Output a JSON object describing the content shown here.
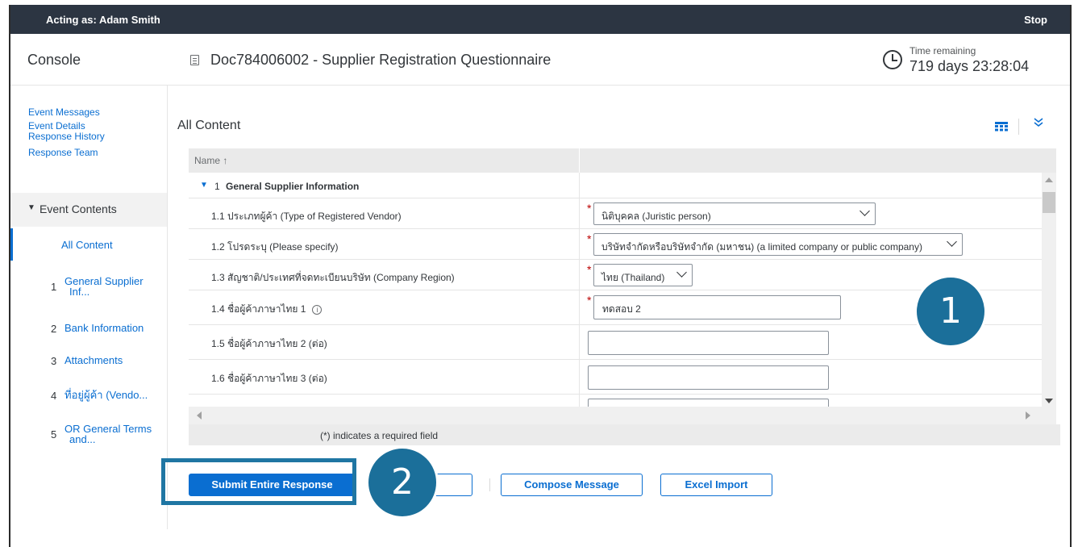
{
  "topbar": {
    "acting_as": "Acting as: Adam Smith",
    "stop": "Stop"
  },
  "header": {
    "console": "Console",
    "doc_title": "Doc784006002 - Supplier Registration Questionnaire",
    "time_label": "Time remaining",
    "time_value": "719 days 23:28:04"
  },
  "sidebar": {
    "links": [
      "Event Messages",
      "Event Details",
      "Response History",
      "Response Team"
    ],
    "event_contents": "Event Contents",
    "all_content": "All Content",
    "items": [
      {
        "num": "1",
        "label1": "General Supplier",
        "label2": "Inf..."
      },
      {
        "num": "2",
        "label1": "Bank Information",
        "label2": ""
      },
      {
        "num": "3",
        "label1": "Attachments",
        "label2": ""
      },
      {
        "num": "4",
        "label1": "ที่อยู่ผู้ค้า (Vendo...",
        "label2": ""
      },
      {
        "num": "5",
        "label1": "OR General Terms",
        "label2": "and..."
      }
    ]
  },
  "main": {
    "title": "All Content",
    "col_name": "Name ↑",
    "section": {
      "num": "1",
      "label": "General Supplier Information"
    },
    "rows": [
      {
        "label": "1.1  ประเภทผู้ค้า (Type of Registered Vendor)",
        "value": "นิติบุคคล (Juristic person)"
      },
      {
        "label": "1.2  โปรดระบุ (Please specify)",
        "value": "บริษัทจำกัดหรือบริษัทจำกัด (มหาชน) (a limited company or public company)"
      },
      {
        "label": "1.3  สัญชาติ/ประเทศที่จดทะเบียนบริษัท (Company Region)",
        "value": "ไทย (Thailand)"
      },
      {
        "label": "1.4  ชื่อผู้ค้าภาษาไทย 1",
        "value": "ทดสอบ 2"
      },
      {
        "label": "1.5  ชื่อผู้ค้าภาษาไทย 2 (ต่อ)",
        "value": ""
      },
      {
        "label": "1.6  ชื่อผู้ค้าภาษาไทย 3 (ต่อ)",
        "value": ""
      }
    ],
    "required_note": "(*) indicates a required field",
    "required_mark": "*",
    "info_glyph": "i"
  },
  "buttons": {
    "submit": "Submit Entire Response",
    "hidden": "",
    "compose": "Compose Message",
    "excel": "Excel Import"
  },
  "badges": {
    "one": "1",
    "two": "2"
  },
  "colors": {
    "accent": "#0a6ed1",
    "topbar": "#2c3542",
    "badge": "#1b6f9a",
    "required": "#bb0000"
  }
}
